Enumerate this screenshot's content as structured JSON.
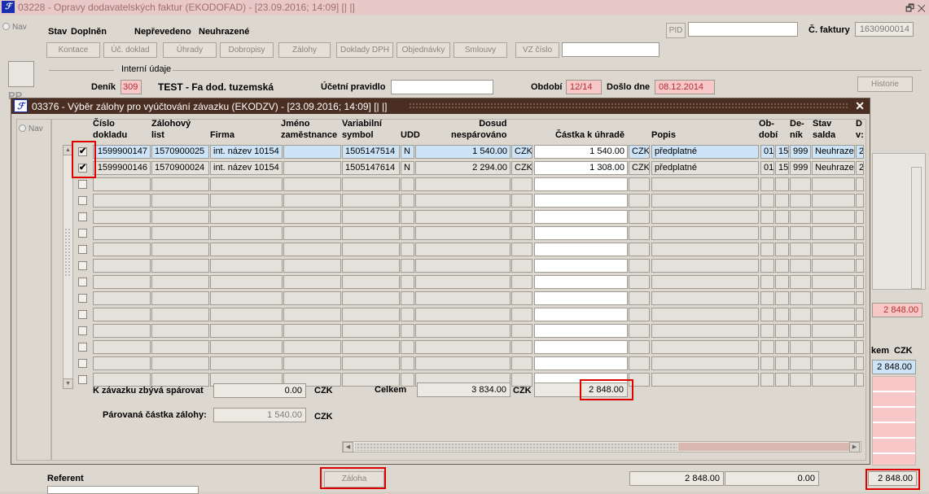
{
  "bg": {
    "title": "03228 - Opravy dodavatelských faktur (EKODOFAD) - [23.09.2016; 14:09]  [|  |]",
    "nav": "Nav",
    "stav_label": "Stav",
    "stav_value": "Doplněn",
    "neprevedeno": "Nepřevedeno",
    "neuhrazene": "Neuhrazené",
    "pid_label": "PID",
    "cfaktury_label": "Č. faktury",
    "cfaktury_value": "1630900014",
    "buttons": [
      "Kontace",
      "Úč. doklad",
      "Úhrady",
      "Dobropisy",
      "Zálohy",
      "Doklady DPH",
      "Objednávky",
      "Smlouvy",
      "VZ číslo"
    ],
    "interni": "Interní údaje",
    "denik_label": "Deník",
    "denik_value": "309",
    "denik_name": "TEST - Fa dod. tuzemská",
    "ucetni_label": "Účetní pravidlo",
    "obdobi_label": "Období",
    "obdobi_value": "12/14",
    "doslo_label": "Došlo dne",
    "doslo_value": "08.12.2014",
    "historie": "Historie",
    "right_total1": "2 848.00",
    "celkem_label": "kem",
    "czk": "CZK",
    "right_total2": "2 848.00",
    "referent": "Referent",
    "zaloha_btn": "Záloha",
    "bottom1": "2 848.00",
    "bottom2": "0.00",
    "bottom3": "2 848.00"
  },
  "dlg": {
    "title": "03376 - Výběr zálohy pro vyúčtování závazku (EKODZV) - [23.09.2016; 14:09]  [|  |]",
    "nav": "Nav",
    "headers": {
      "cislo": "Číslo\ndokladu",
      "zal": "Zálohový\nlist",
      "firma": "Firma",
      "jmeno": "Jméno\nzaměstnance",
      "vs": "Variabilní\nsymbol",
      "udd": "UDD",
      "dosud": "Dosud\nnespárováno",
      "castka": "Částka k úhradě",
      "popis": "Popis",
      "obdobi": "Ob-\ndobí",
      "denik": "De-\nník",
      "stav": "Stav\nsalda",
      "d": "D\nv:"
    },
    "rows": [
      {
        "checked": true,
        "cislo": "1599900147",
        "zal": "1570900025",
        "firma": "int. název 10154",
        "jmeno": "",
        "vs": "1505147514",
        "udd": "N",
        "dosud": "1 540.00",
        "mena1": "CZK",
        "castka": "1 540.00",
        "mena2": "CZK",
        "popis": "předplatné",
        "obd": "01",
        "o2": "15",
        "denik": "999",
        "stav": "Neuhrazen",
        "d": "2"
      },
      {
        "checked": true,
        "cislo": "1599900146",
        "zal": "1570900024",
        "firma": "int. název 10154",
        "jmeno": "",
        "vs": "1505147614",
        "udd": "N",
        "dosud": "2 294.00",
        "mena1": "CZK",
        "castka": "1 308.00",
        "mena2": "CZK",
        "popis": "předplatné",
        "obd": "01",
        "o2": "15",
        "denik": "999",
        "stav": "Neuhrazen",
        "d": "2"
      }
    ],
    "zbyva_label": "K závazku zbývá spárovat",
    "zbyva_value": "0.00",
    "czk": "CZK",
    "celkem_label": "Celkem",
    "celkem_value": "3 834.00",
    "celkem_uhrada": "2 848.00",
    "parovana_label": "Párovaná částka zálohy:",
    "parovana_value": "1 540.00"
  }
}
